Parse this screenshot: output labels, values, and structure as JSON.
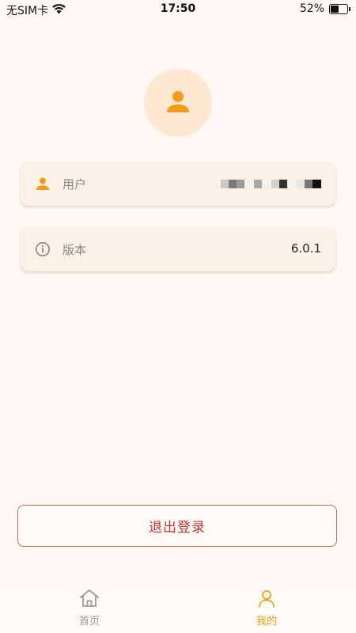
{
  "status_bar": {
    "carrier": "无SIM卡",
    "time": "17:50",
    "battery_text": "52%",
    "battery_level": 0.52
  },
  "profile": {
    "avatar_icon": "user-icon"
  },
  "info_cards": {
    "user": {
      "label": "用户",
      "icon": "user-icon"
    },
    "version": {
      "label": "版本",
      "value": "6.0.1",
      "icon": "info-icon"
    }
  },
  "logout_label": "退出登录",
  "tabbar": {
    "home_label": "首页",
    "home_icon": "home-icon",
    "mine_label": "我的",
    "mine_icon": "person-outline-icon"
  },
  "colors": {
    "background": "#fff8f5",
    "accent": "#e4a11b",
    "icon_orange": "#f29b1d",
    "logout_red": "#b5372d",
    "card_bg": "#fbf1e6"
  }
}
